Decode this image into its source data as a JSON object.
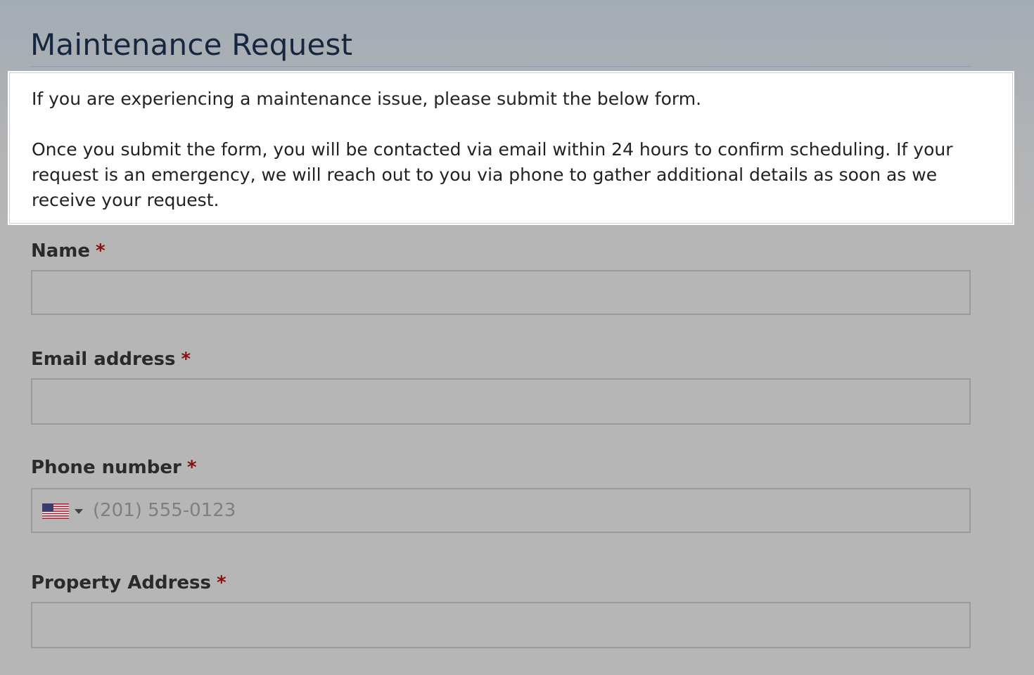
{
  "page": {
    "title": "Maintenance Request"
  },
  "intro": {
    "paragraph1": "If you are experiencing a maintenance issue, please submit the below form.",
    "paragraph2": "Once you submit the form, you will be contacted via email within 24 hours to confirm scheduling. If your request is an emergency, we will reach out to you via phone to gather additional details as soon as we receive your request."
  },
  "form": {
    "required_marker": "*",
    "name": {
      "label": "Name",
      "value": "",
      "placeholder": ""
    },
    "email": {
      "label": "Email address",
      "value": "",
      "placeholder": ""
    },
    "phone": {
      "label": "Phone number",
      "value": "",
      "placeholder": "(201) 555-0123",
      "country_flag_icon": "us-flag-icon"
    },
    "property_address": {
      "label": "Property Address",
      "value": "",
      "placeholder": ""
    }
  },
  "colors": {
    "title": "#15263f",
    "required": "#8a0e0e",
    "input_border": "#9a9a9a"
  }
}
